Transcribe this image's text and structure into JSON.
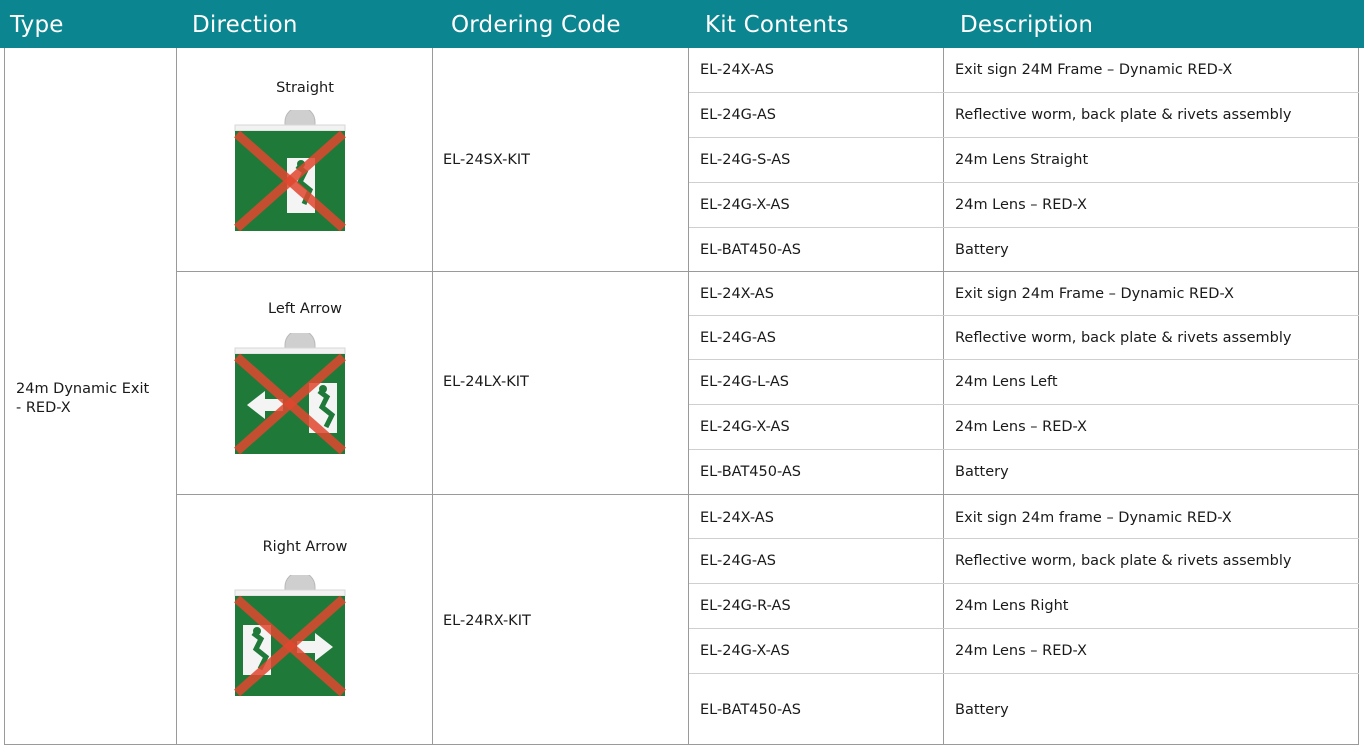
{
  "header": {
    "type": "Type",
    "direction": "Direction",
    "ordering_code": "Ordering Code",
    "kit_contents": "Kit Contents",
    "description": "Description"
  },
  "type_label": "24m Dynamic Exit\n- RED-X",
  "groups": [
    {
      "direction": "Straight",
      "icon": "exit-sign-straight-icon",
      "ordering_code": "EL-24SX-KIT",
      "items": [
        {
          "kit": "EL-24X-AS",
          "desc": "Exit sign 24M Frame – Dynamic RED-X"
        },
        {
          "kit": "EL-24G-AS",
          "desc": "Reflective worm, back plate & rivets assembly"
        },
        {
          "kit": "EL-24G-S-AS",
          "desc": "24m Lens Straight"
        },
        {
          "kit": "EL-24G-X-AS",
          "desc": "24m Lens – RED-X"
        },
        {
          "kit": "EL-BAT450-AS",
          "desc": "Battery"
        }
      ]
    },
    {
      "direction": "Left Arrow",
      "icon": "exit-sign-left-arrow-icon",
      "ordering_code": "EL-24LX-KIT",
      "items": [
        {
          "kit": "EL-24X-AS",
          "desc": "Exit sign 24m Frame – Dynamic RED-X"
        },
        {
          "kit": "EL-24G-AS",
          "desc": "Reflective worm, back plate & rivets assembly"
        },
        {
          "kit": "EL-24G-L-AS",
          "desc": "24m Lens Left"
        },
        {
          "kit": "EL-24G-X-AS",
          "desc": "24m Lens – RED-X"
        },
        {
          "kit": "EL-BAT450-AS",
          "desc": "Battery"
        }
      ]
    },
    {
      "direction": "Right Arrow",
      "icon": "exit-sign-right-arrow-icon",
      "ordering_code": "EL-24RX-KIT",
      "items": [
        {
          "kit": "EL-24X-AS",
          "desc": "Exit sign 24m frame – Dynamic RED-X"
        },
        {
          "kit": "EL-24G-AS",
          "desc": "Reflective worm, back plate & rivets assembly"
        },
        {
          "kit": "EL-24G-R-AS",
          "desc": "24m Lens Right"
        },
        {
          "kit": "EL-24G-X-AS",
          "desc": "24m Lens – RED-X"
        },
        {
          "kit": "EL-BAT450-AS",
          "desc": "Battery"
        }
      ]
    }
  ],
  "colors": {
    "header_bg": "#0b8690",
    "sign_green": "#1f7a3a",
    "cross_red": "#e0472f"
  }
}
